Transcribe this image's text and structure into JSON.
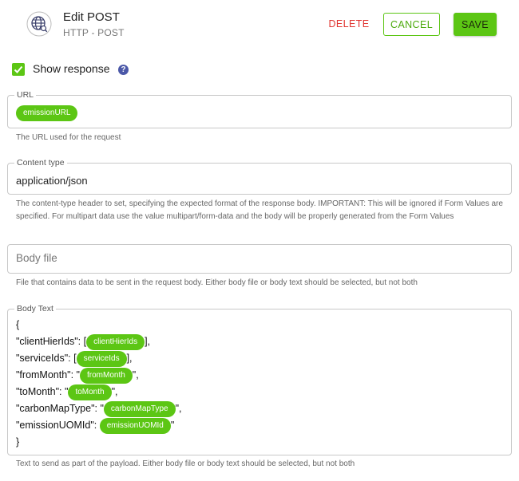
{
  "header": {
    "title": "Edit POST",
    "subtitle": "HTTP - POST",
    "icon": "globe-icon",
    "delete_label": "DELETE",
    "cancel_label": "CANCEL",
    "save_label": "SAVE"
  },
  "show_response": {
    "label": "Show response",
    "checked": true,
    "help_glyph": "?"
  },
  "url": {
    "label": "URL",
    "chip": "emissionURL",
    "helper": "The URL used for the request"
  },
  "content_type": {
    "label": "Content type",
    "value": "application/json",
    "helper": "The content-type header to set, specifying the expected format of the response body. IMPORTANT: This will be ignored if Form Values are specified. For multipart data use the value multipart/form-data and the body will be properly generated from the Form Values"
  },
  "body_file": {
    "placeholder": "Body file",
    "helper": "File that contains data to be sent in the request body. Either body file or body text should be selected, but not both"
  },
  "body_text": {
    "label": "Body Text",
    "open_brace": "{",
    "close_brace": "}",
    "lines": [
      {
        "key": "\"clientHierIds\": [",
        "chip": "clientHierIds",
        "suffix": "],"
      },
      {
        "key": "\"serviceIds\": [",
        "chip": "serviceIds",
        "suffix": "],"
      },
      {
        "key": "\"fromMonth\": \"",
        "chip": "fromMonth",
        "suffix": "\","
      },
      {
        "key": "\"toMonth\": \"",
        "chip": "toMonth",
        "suffix": "\","
      },
      {
        "key": "\"carbonMapType\": \"",
        "chip": "carbonMapType",
        "suffix": "\","
      },
      {
        "key": "\"emissionUOMId\": ",
        "chip": "emissionUOMId",
        "suffix": "\""
      }
    ],
    "helper": "Text to send as part of the payload. Either body file or body text should be selected, but not both"
  },
  "colors": {
    "accent_green": "#5cc614",
    "delete_red": "#e0332f",
    "help_blue": "#4b58a8"
  }
}
